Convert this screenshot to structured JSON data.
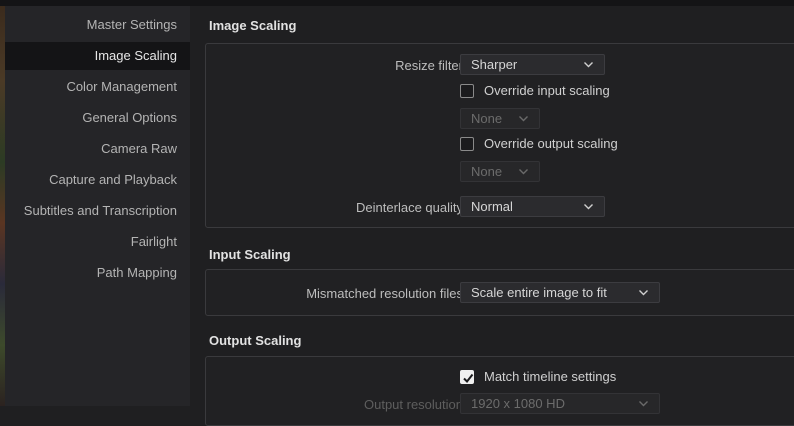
{
  "sidebar": {
    "items": [
      {
        "label": "Master Settings",
        "active": false
      },
      {
        "label": "Image Scaling",
        "active": true
      },
      {
        "label": "Color Management",
        "active": false
      },
      {
        "label": "General Options",
        "active": false
      },
      {
        "label": "Camera Raw",
        "active": false
      },
      {
        "label": "Capture and Playback",
        "active": false
      },
      {
        "label": "Subtitles and Transcription",
        "active": false
      },
      {
        "label": "Fairlight",
        "active": false
      },
      {
        "label": "Path Mapping",
        "active": false
      }
    ]
  },
  "image_scaling": {
    "title": "Image Scaling",
    "resize_filter_label": "Resize filter",
    "resize_filter_value": "Sharper",
    "override_input_label": "Override input scaling",
    "override_input_checked": false,
    "override_input_value": "None",
    "override_output_label": "Override output scaling",
    "override_output_checked": false,
    "override_output_value": "None",
    "deinterlace_label": "Deinterlace quality",
    "deinterlace_value": "Normal"
  },
  "input_scaling": {
    "title": "Input Scaling",
    "mismatched_label": "Mismatched resolution files",
    "mismatched_value": "Scale entire image to fit"
  },
  "output_scaling": {
    "title": "Output Scaling",
    "match_timeline_label": "Match timeline settings",
    "match_timeline_checked": true,
    "output_resolution_label": "Output resolution",
    "output_resolution_value": "1920 x 1080 HD"
  },
  "colors": {
    "background": "#1f1f21",
    "sidebar": "#252528",
    "active_item": "#141416"
  }
}
